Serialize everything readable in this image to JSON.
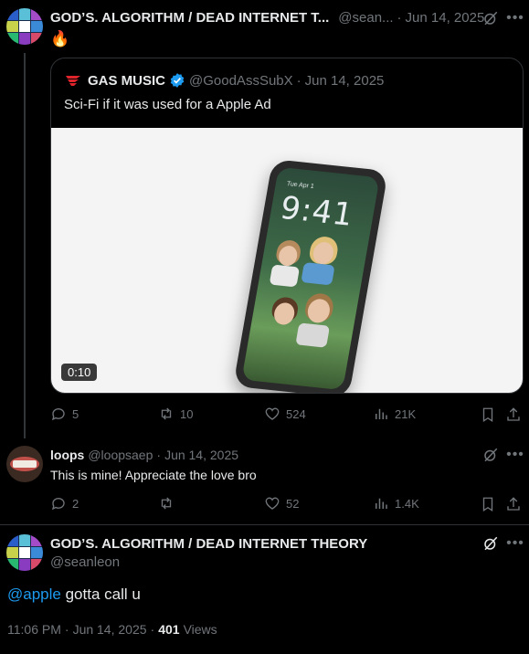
{
  "post1": {
    "name": "GOD’S. ALGORITHM / DEAD INTERNET T...",
    "handle": "@sean...",
    "dot": "·",
    "date": "Jun 14, 2025",
    "text": "🔥",
    "quote": {
      "name": "GAS MUSIC",
      "handle": "@GoodAssSubX",
      "dot": "·",
      "date": "Jun 14, 2025",
      "text": "Sci-Fi if it was used for a Apple Ad",
      "phone_time": "9:41",
      "phone_date": "Tue Apr 1",
      "duration": "0:10"
    },
    "stats": {
      "replies": "5",
      "reposts": "10",
      "likes": "524",
      "views": "21K"
    }
  },
  "reply": {
    "name": "loops",
    "handle": "@loopsaep",
    "dot": "·",
    "date": "Jun 14, 2025",
    "text": "This is mine! Appreciate the love bro",
    "stats": {
      "replies": "2",
      "reposts": "",
      "likes": "52",
      "views": "1.4K"
    }
  },
  "main": {
    "name": "GOD’S. ALGORITHM / DEAD INTERNET THEORY",
    "handle": "@seanleon",
    "mention": "@apple",
    "text": " gotta call u",
    "time": "11:06 PM",
    "dot": "·",
    "date": "Jun 14, 2025",
    "dot2": "·",
    "views_count": "401",
    "views_label": "Views"
  },
  "colors": {
    "accent": "#1d9bf0",
    "text": "#e7e9ea",
    "muted": "#71767b",
    "border": "#2f3336",
    "verified": "#1d9bf0",
    "brand_red": "#e0242c"
  }
}
